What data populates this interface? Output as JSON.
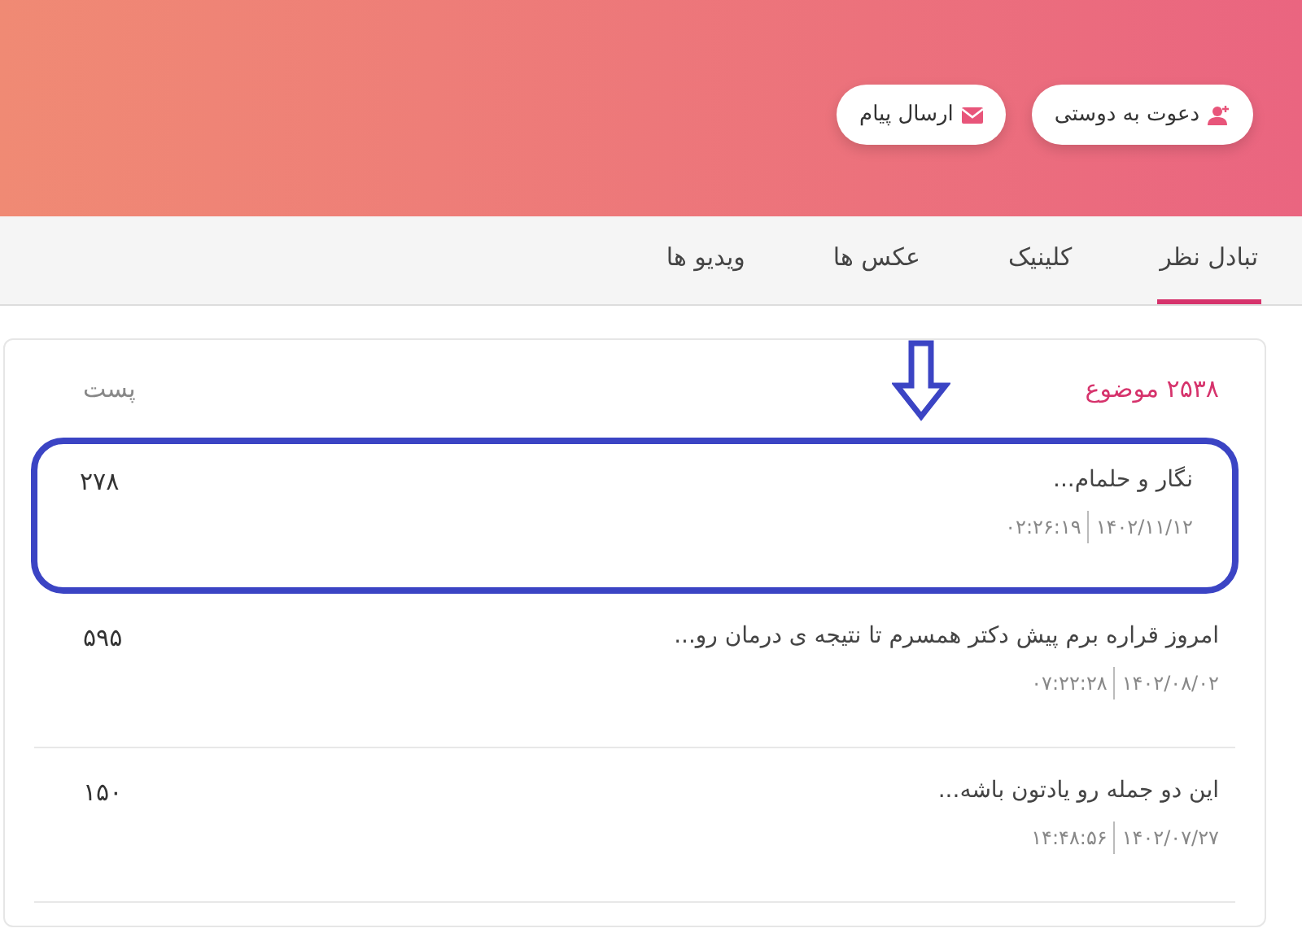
{
  "header": {
    "buttons": [
      {
        "label": "دعوت به دوستی",
        "kind": "invite"
      },
      {
        "label": "ارسال پیام",
        "kind": "message"
      }
    ]
  },
  "tabs": [
    {
      "label": "تبادل نظر",
      "selected": true
    },
    {
      "label": "کلینیک",
      "selected": false
    },
    {
      "label": "عکس ها",
      "selected": false
    },
    {
      "label": "ویدیو ها",
      "selected": false
    }
  ],
  "topics": {
    "count_label": "۲۵۳۸ موضوع",
    "column_label": "پست",
    "rows": [
      {
        "title": "نگار و حلمام...",
        "date": "۱۴۰۲/۱۱/۱۲",
        "time": "۰۲:۲۶:۱۹",
        "posts": "۲۷۸",
        "highlighted": true
      },
      {
        "title": "امروز قراره برم پیش دکتر همسرم تا نتیجه ی درمان رو...",
        "date": "۱۴۰۲/۰۸/۰۲",
        "time": "۰۷:۲۲:۲۸",
        "posts": "۵۹۵",
        "highlighted": false
      },
      {
        "title": "این دو جمله رو یادتون باشه...",
        "date": "۱۴۰۲/۰۷/۲۷",
        "time": "۱۴:۴۸:۵۶",
        "posts": "۱۵۰",
        "highlighted": false
      }
    ]
  }
}
